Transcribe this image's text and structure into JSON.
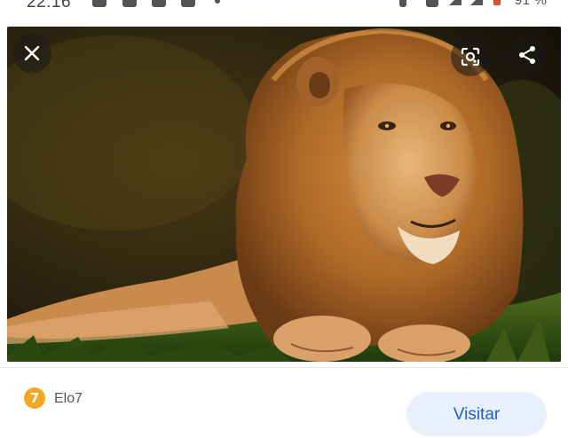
{
  "status_bar": {
    "time": "22:16",
    "battery": "91 %"
  },
  "viewer": {
    "close_icon": "close-icon",
    "lens_icon": "google-lens-icon",
    "share_icon": "share-icon",
    "image_subject": "lion"
  },
  "source": {
    "favicon_letter": "7",
    "site_name": "Elo7",
    "visit_label": "Visitar",
    "accent": "#1a5fd6",
    "favicon_color": "#f4a723"
  }
}
